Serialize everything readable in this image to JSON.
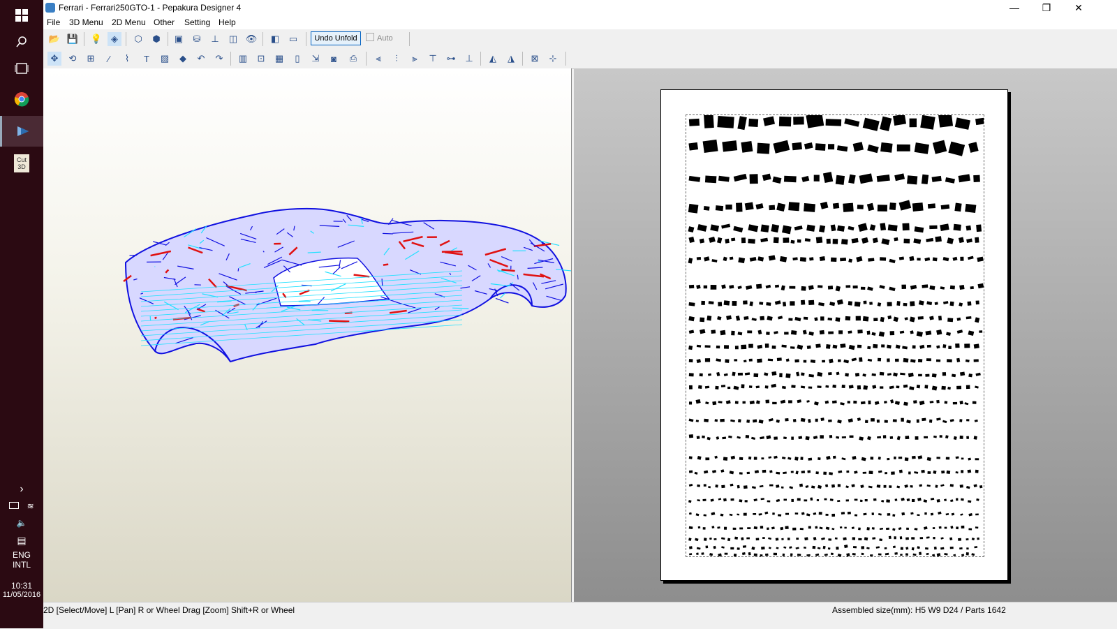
{
  "window": {
    "title": "Ferrari - Ferrari250GTO-1 - Pepakura Designer 4",
    "controls": {
      "minimize": "—",
      "restore": "❐",
      "close": "✕"
    }
  },
  "menu": [
    "File",
    "3D Menu",
    "2D Menu",
    "Other",
    "Setting",
    "Help"
  ],
  "toolbar": {
    "undo_unfold_label": "Undo Unfold",
    "auto_label": "Auto"
  },
  "status": {
    "left": "2D [Select/Move] L [Pan] R or Wheel Drag [Zoom] Shift+R or Wheel",
    "right": "Assembled size(mm): H5 W9 D24 / Parts 1642"
  },
  "taskbar": {
    "language_line1": "ENG",
    "language_line2": "INTL",
    "time": "10:31",
    "date": "11/05/2016",
    "apps": [
      "windows-start",
      "search",
      "task-view",
      "chrome",
      "pepakura",
      "cut3d"
    ],
    "cut3d_label_1": "Cut",
    "cut3d_label_2": "3D"
  },
  "colors": {
    "mesh_blue": "#1010e0",
    "mesh_cyan": "#20e0ff",
    "cut_red": "#e01010",
    "body_fill": "#d8d8ff"
  }
}
